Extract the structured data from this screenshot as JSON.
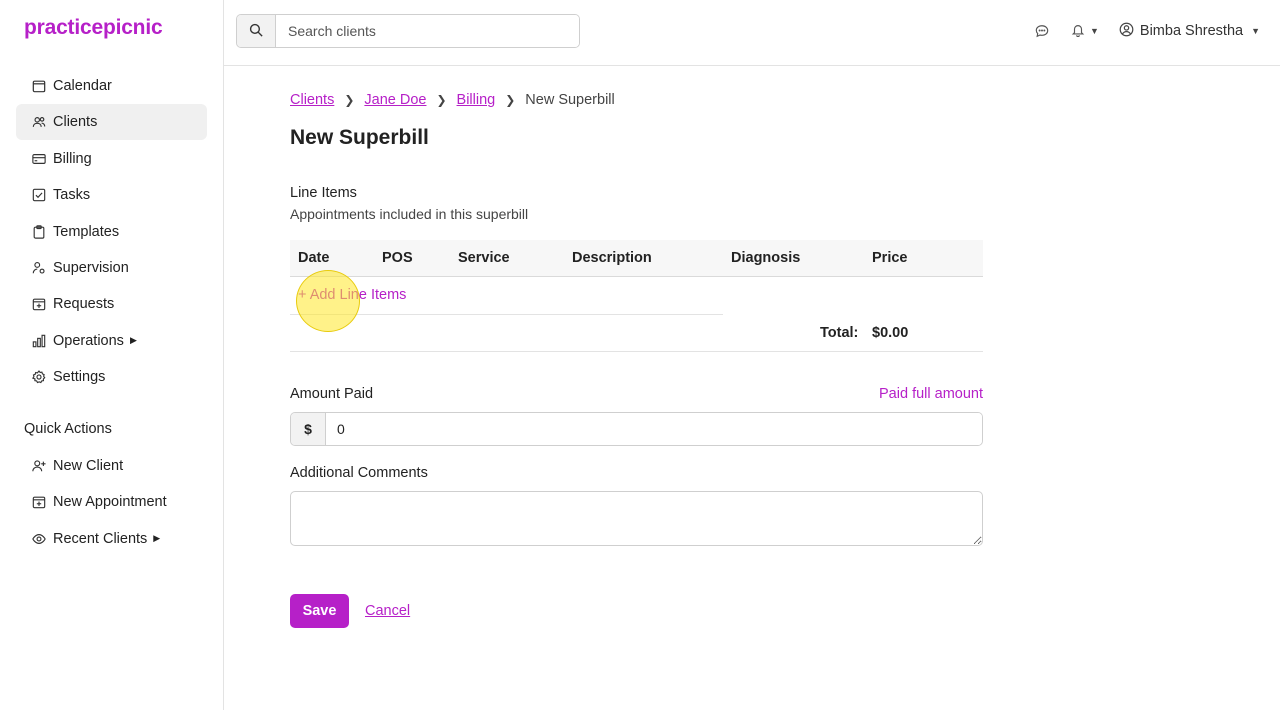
{
  "app": {
    "logo": "practicepicnic",
    "brand_color": "#b620c8"
  },
  "sidebar": {
    "items": [
      {
        "label": "Calendar",
        "icon": "calendar-icon"
      },
      {
        "label": "Clients",
        "icon": "users-icon",
        "active": true
      },
      {
        "label": "Billing",
        "icon": "credit-card-icon"
      },
      {
        "label": "Tasks",
        "icon": "check-square-icon"
      },
      {
        "label": "Templates",
        "icon": "clipboard-icon"
      },
      {
        "label": "Supervision",
        "icon": "user-gear-icon"
      },
      {
        "label": "Requests",
        "icon": "calendar-plus-icon"
      },
      {
        "label": "Operations",
        "icon": "bar-chart-icon"
      },
      {
        "label": "Settings",
        "icon": "gear-icon"
      }
    ],
    "quick_actions_title": "Quick Actions",
    "quick_actions": [
      {
        "label": "New Client",
        "icon": "user-plus-icon"
      },
      {
        "label": "New Appointment",
        "icon": "calendar-plus-icon"
      },
      {
        "label": "Recent Clients",
        "icon": "eye-icon"
      }
    ]
  },
  "header": {
    "search_placeholder": "Search clients",
    "user_name": "Bimba Shrestha"
  },
  "breadcrumb": {
    "items": [
      "Clients",
      "Jane Doe",
      "Billing"
    ],
    "current": "New Superbill"
  },
  "page": {
    "title": "New Superbill",
    "line_items_title": "Line Items",
    "line_items_subtitle": "Appointments included in this superbill",
    "table": {
      "columns": [
        "Date",
        "POS",
        "Service",
        "Description",
        "Diagnosis",
        "Price"
      ],
      "add_link": "+ Add Line Items",
      "total_label": "Total:",
      "total_value": "$0.00"
    },
    "amount_paid_label": "Amount Paid",
    "paid_full_link": "Paid full amount",
    "amount_prefix": "$",
    "amount_value": "0",
    "comments_label": "Additional Comments",
    "save_label": "Save",
    "cancel_label": "Cancel"
  }
}
